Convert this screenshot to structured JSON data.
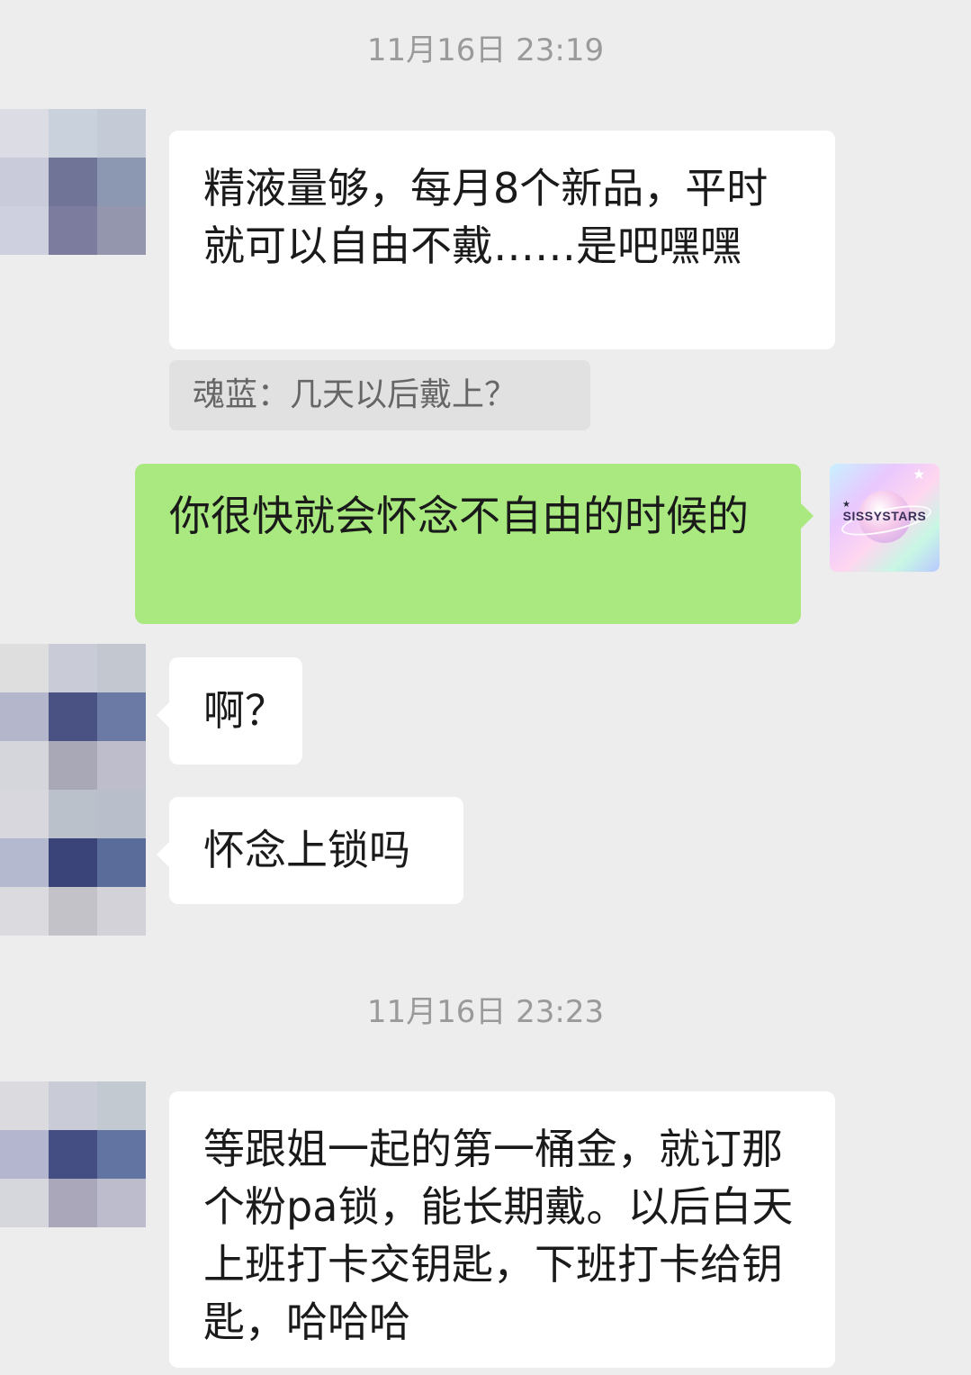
{
  "chat": {
    "timestamps": [
      "11月16日 23:19",
      "11月16日 23:23"
    ],
    "messages": [
      {
        "sender": "other",
        "text": "精液量够，每月8个新品，平时就可以自由不戴……是吧嘿嘿"
      },
      {
        "sender": "other",
        "quote": "魂蓝：几天以后戴上？"
      },
      {
        "sender": "self",
        "text": "你很快就会怀念不自由的时候的"
      },
      {
        "sender": "other",
        "text": "啊？"
      },
      {
        "sender": "other",
        "text": "怀念上锁吗"
      },
      {
        "sender": "other",
        "text": "等跟姐一起的第一桶金，就订那个粉pa锁，能长期戴。以后白天上班打卡交钥匙，下班打卡给钥匙，哈哈哈"
      }
    ]
  },
  "self_avatar": {
    "brand_text": "SISSYSTARS",
    "colors": [
      "#c8f0ff",
      "#e8c8ff",
      "#ffd6f0",
      "#c8f7e4",
      "#b9c9ff"
    ]
  },
  "mosaic_colors": {
    "avatar1": [
      "#dcdce4",
      "#c9d2dc",
      "#c4cbd7",
      "#c9cbda",
      "#707497",
      "#8c98b1",
      "#cfd0df",
      "#7c7c9f",
      "#9396ac"
    ],
    "avatar2": [
      "#dededf",
      "#c9ccd6",
      "#c2c7d0",
      "#b4b6cc",
      "#4a5283",
      "#6a7aa4",
      "#d5d5dc",
      "#a8a8b6",
      "#bebdcc",
      "#d8d7de",
      "#bac1ca",
      "#b8bfcb",
      "#b4b9cf",
      "#3a4478",
      "#5a6c9a",
      "#dadadf",
      "#c4c2c9",
      "#d3d2d8"
    ],
    "avatar3": [
      "#dadadf",
      "#c9ccd6",
      "#c3c9d1",
      "#b3b6ce",
      "#454e82",
      "#6174a2",
      "#d6d6dd",
      "#a9a7b9",
      "#bcbccc"
    ]
  },
  "colors": {
    "background": "#ededed",
    "incoming_bubble": "#ffffff",
    "outgoing_bubble": "#a9e97f",
    "quote_bg": "#e1e1e1"
  }
}
